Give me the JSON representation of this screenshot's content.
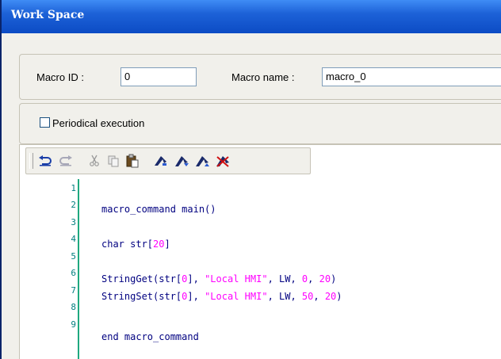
{
  "window": {
    "title": "Work Space"
  },
  "macro": {
    "id_label": "Macro ID :",
    "id_value": "0",
    "name_label": "Macro name :",
    "name_value": "macro_0"
  },
  "periodical": {
    "label": "Periodical execution",
    "checked": false
  },
  "toolbar": {
    "buttons": [
      "undo-icon",
      "redo-icon",
      "cut-icon",
      "copy-icon",
      "paste-icon",
      "bookmark-toggle-icon",
      "bookmark-next-icon",
      "bookmark-prev-icon",
      "bookmark-clear-icon"
    ]
  },
  "editor": {
    "line_numbers": [
      "1",
      "2",
      "3",
      "4",
      "5",
      "6",
      "7",
      "8",
      "9"
    ],
    "lines": {
      "l2": "macro_command main()",
      "l4a": "char str[",
      "l4b": "20",
      "l4c": "]",
      "l6a": "StringGet(str[",
      "l6b": "0",
      "l6c": "], ",
      "l6d": "\"Local HMI\"",
      "l6e": ", LW, ",
      "l6f": "0",
      "l6g": ", ",
      "l6h": "20",
      "l6i": ")",
      "l7a": "StringSet(str[",
      "l7b": "0",
      "l7c": "], ",
      "l7d": "\"Local HMI\"",
      "l7e": ", LW, ",
      "l7f": "50",
      "l7g": ", ",
      "l7h": "20",
      "l7i": ")",
      "l9": "end macro_command"
    }
  },
  "colors": {
    "title_bar": "#1d62d8",
    "code_text": "#000080",
    "literal": "#ff00ff",
    "line_number": "#007f7f"
  }
}
